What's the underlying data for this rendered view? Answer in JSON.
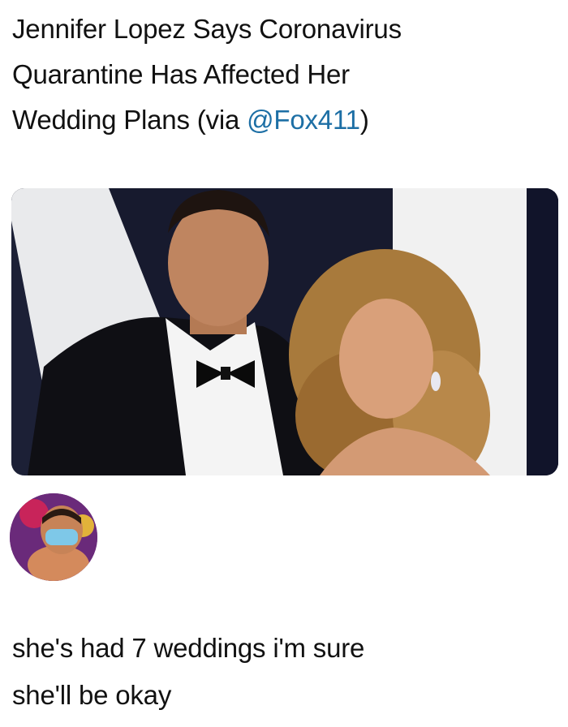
{
  "headline": {
    "line1": "Jennifer Lopez Says Coronavirus",
    "line2": "Quarantine Has Affected Her",
    "line3_prefix": "Wedding Plans (via ",
    "mention": "@Fox411",
    "line3_suffix": ")"
  },
  "reply": {
    "line1": "she's had 7 weddings i'm sure",
    "line2": "she'll be okay"
  },
  "colors": {
    "mention": "#1d6fa5",
    "text": "#111111",
    "background": "#ffffff"
  }
}
